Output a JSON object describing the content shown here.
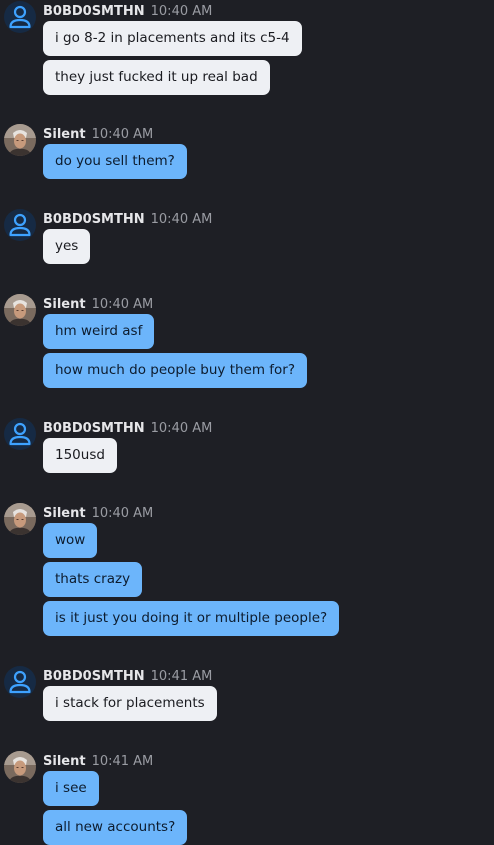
{
  "colors": {
    "background": "#1e1f25",
    "incoming_bubble": "#eef0f4",
    "outgoing_bubble": "#6cb5fb",
    "default_avatar": "#3ea2ff"
  },
  "groups": [
    {
      "sender": "B0BD0SMTHN",
      "time": "10:40 AM",
      "avatar_icon": "default-user-icon",
      "messages": [
        "i go 8-2 in placements and its c5-4",
        "they just fucked it up real bad"
      ]
    },
    {
      "sender": "Silent",
      "time": "10:40 AM",
      "avatar_icon": "profile-photo",
      "messages": [
        "do you sell them?"
      ]
    },
    {
      "sender": "B0BD0SMTHN",
      "time": "10:40 AM",
      "avatar_icon": "default-user-icon",
      "messages": [
        "yes"
      ]
    },
    {
      "sender": "Silent",
      "time": "10:40 AM",
      "avatar_icon": "profile-photo",
      "messages": [
        "hm weird asf",
        "how much do people buy them for?"
      ]
    },
    {
      "sender": "B0BD0SMTHN",
      "time": "10:40 AM",
      "avatar_icon": "default-user-icon",
      "messages": [
        "150usd"
      ]
    },
    {
      "sender": "Silent",
      "time": "10:40 AM",
      "avatar_icon": "profile-photo",
      "messages": [
        "wow",
        "thats crazy",
        "is it just you doing it or multiple people?"
      ]
    },
    {
      "sender": "B0BD0SMTHN",
      "time": "10:41 AM",
      "avatar_icon": "default-user-icon",
      "messages": [
        "i stack for placements"
      ]
    },
    {
      "sender": "Silent",
      "time": "10:41 AM",
      "avatar_icon": "profile-photo",
      "messages": [
        "i see",
        "all new accounts?"
      ]
    }
  ]
}
